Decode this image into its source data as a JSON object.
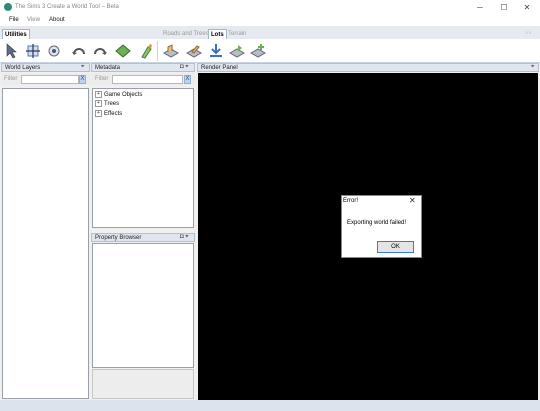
{
  "window": {
    "title": "The Sims 3 Create a World Tool – Beta",
    "minimize": "─",
    "maximize": "☐",
    "close": "✕"
  },
  "menu": [
    "File",
    "View",
    "About"
  ],
  "tabs": {
    "utilities": "Utilities",
    "roads_and_trees": "Roads and Trees",
    "lots": "Lots",
    "terrain": "Terrain",
    "strip_controls": "‹ ›"
  },
  "ribbon_icons": [
    "select-arrow-icon",
    "move-icon",
    "view-icon",
    "undo-icon",
    "redo-icon",
    "terrain-paint-icon",
    "paint-brush-icon",
    "lot-icon",
    "lot-edit-icon",
    "lot-download-icon",
    "lot-export-icon",
    "lot-add-icon"
  ],
  "panels": {
    "world_layers": {
      "title": "World Layers",
      "pin": "⌖",
      "filter_label": "Filter",
      "filter_button": "X"
    },
    "metadata": {
      "title": "Metadata",
      "buttons": "◘ ⌖",
      "filter_label": "Filter",
      "filter_button": "X",
      "tree": [
        {
          "expander": "+",
          "label": "Game Objects"
        },
        {
          "expander": "+",
          "label": "Trees"
        },
        {
          "expander": "+",
          "label": "Effects"
        }
      ]
    },
    "property_browser": {
      "title": "Property Browser",
      "buttons": "◘ ⌖"
    },
    "render_panel": {
      "title": "Render Panel",
      "pin": "⌖"
    }
  },
  "dialog": {
    "title": "Error!",
    "close": "✕",
    "message": "Exporting world failed!",
    "ok": "OK"
  },
  "colors": {
    "accent": "#3a7bd5",
    "panel_header": "#e0e6ef",
    "render_bg": "#000000"
  }
}
